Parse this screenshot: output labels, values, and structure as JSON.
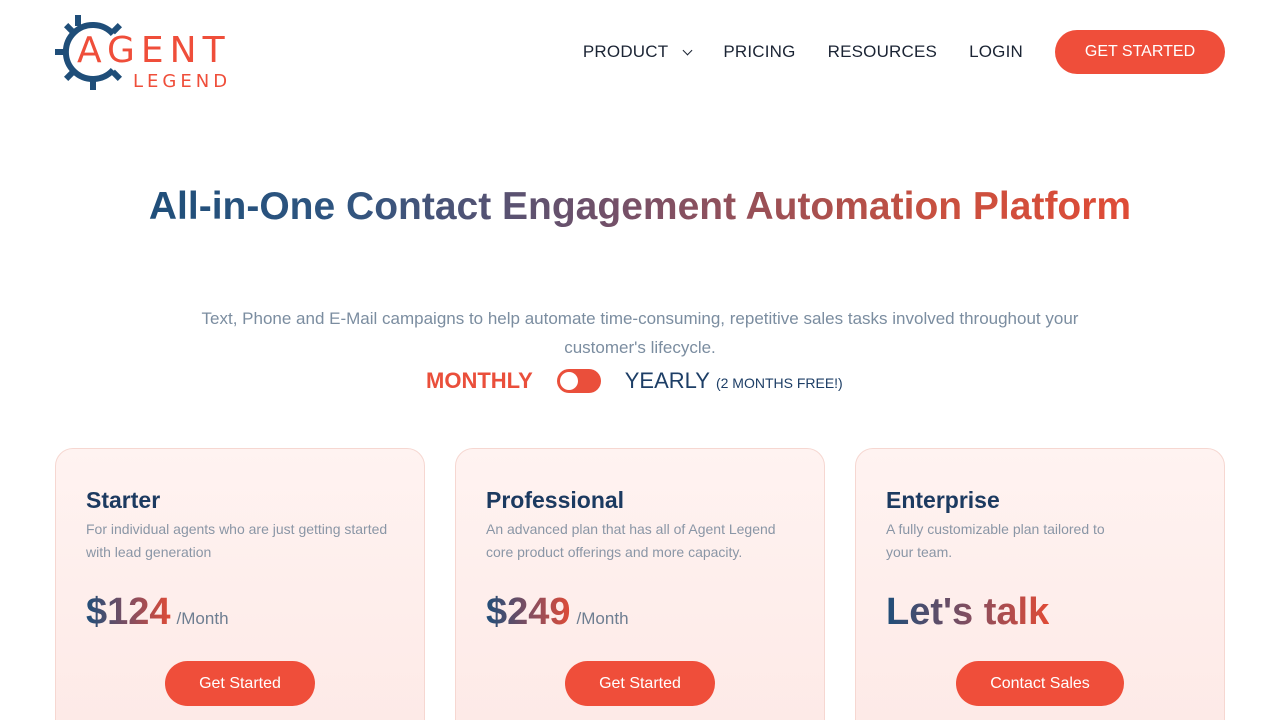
{
  "brand": {
    "logo_word_1": "AGENT",
    "logo_word_2": "LEGEND",
    "colors": {
      "blue": "#1f4e79",
      "red": "#ef4e3a"
    }
  },
  "nav": {
    "items": [
      {
        "label": "PRODUCT",
        "has_dropdown": true
      },
      {
        "label": "PRICING"
      },
      {
        "label": "RESOURCES"
      },
      {
        "label": "LOGIN"
      }
    ],
    "cta": "GET STARTED"
  },
  "hero": {
    "title": "All-in-One Contact Engagement Automation Platform",
    "subtitle": "Text, Phone and E-Mail campaigns to help automate time-consuming, repetitive sales tasks involved throughout your customer's lifecycle."
  },
  "billing": {
    "monthly_label": "MONTHLY",
    "yearly_label": "YEARLY",
    "yearly_note": "(2 MONTHS FREE!)",
    "selected": "monthly"
  },
  "plans": [
    {
      "name": "Starter",
      "description": "For individual agents who are just getting started with lead generation",
      "price": "$124",
      "period": "/Month",
      "button": "Get Started"
    },
    {
      "name": "Professional",
      "description": "An advanced plan that has all of Agent Legend core product offerings and more capacity.",
      "price": "$249",
      "period": "/Month",
      "button": "Get Started"
    },
    {
      "name": "Enterprise",
      "description": "A fully customizable plan tailored to your team.",
      "price": "Let's talk",
      "period": "",
      "button": "Contact Sales"
    }
  ]
}
